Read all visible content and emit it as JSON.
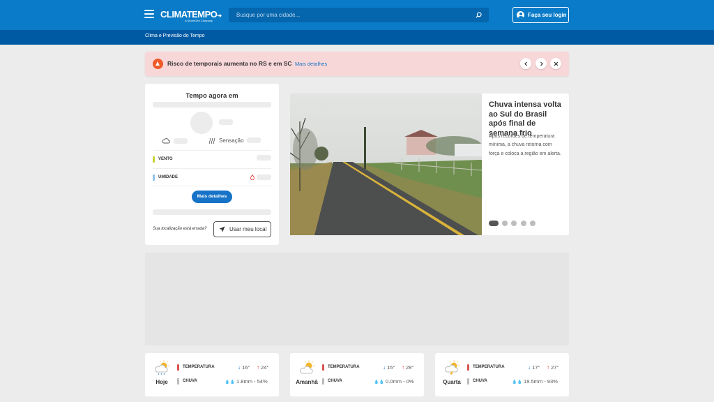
{
  "header": {
    "logo_text": "CLIMATEMPO",
    "logo_sub": "A StormGeo Company",
    "search_placeholder": "Busque por uma cidade...",
    "login_label": "Faça seu login",
    "breadcrumb": "Clima e Previsão do Tempo"
  },
  "alert": {
    "text": "Risco de temporais aumenta no RS e em SC",
    "link": "Mais detalhes"
  },
  "weather_now": {
    "title": "Tempo agora em",
    "sensation_label": "Sensação",
    "wind_label": "VENTO",
    "humidity_label": "UMIDADE",
    "details_button": "Mais detalhes",
    "location_question": "Sua localização está errada?",
    "location_button": "Usar meu local"
  },
  "news": {
    "title": "Chuva intensa volta ao Sul do Brasil após final de semana frio",
    "description": "Após recordes de temperatura mínima, a chuva retorna com força e coloca a região em alerta.",
    "slides": 5,
    "active_slide": 1
  },
  "forecast": [
    {
      "day": "Hoje",
      "temp_label": "TEMPERATURA",
      "rain_label": "CHUVA",
      "min": "16°",
      "max": "24°",
      "rain": "1.8mm - 54%"
    },
    {
      "day": "Amanhã",
      "temp_label": "TEMPERATURA",
      "rain_label": "CHUVA",
      "min": "15°",
      "max": "28°",
      "rain": "0.0mm - 0%"
    },
    {
      "day": "Quarta",
      "temp_label": "TEMPERATURA",
      "rain_label": "CHUVA",
      "min": "17°",
      "max": "27°",
      "rain": "19.5mm - 93%"
    }
  ],
  "colors": {
    "header": "#0a7bc8",
    "subheader": "#005aa3",
    "accent": "#1673c7",
    "alert_bg": "#f8d7d9",
    "alert_icon": "#ef5a29"
  }
}
